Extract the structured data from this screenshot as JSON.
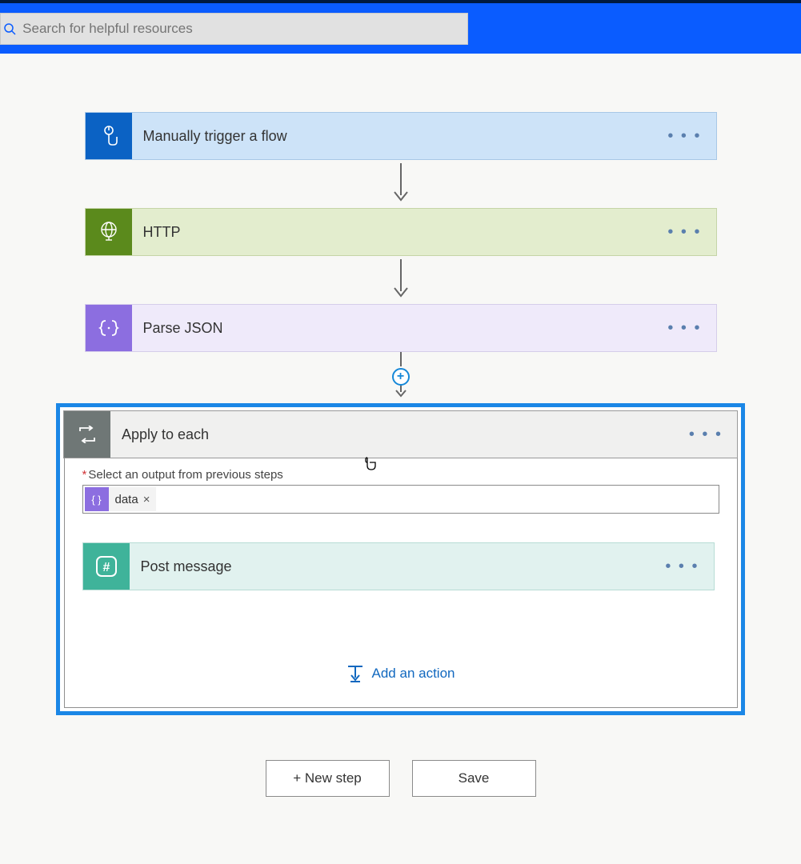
{
  "search": {
    "placeholder": "Search for helpful resources"
  },
  "steps": {
    "trigger": {
      "label": "Manually trigger a flow"
    },
    "http": {
      "label": "HTTP"
    },
    "parse": {
      "label": "Parse JSON"
    },
    "apply": {
      "label": "Apply to each",
      "field_label": "Select an output from previous steps",
      "token": "data",
      "post": {
        "label": "Post message"
      },
      "add_action": "Add an action"
    }
  },
  "buttons": {
    "new_step": "+ New step",
    "save": "Save"
  }
}
